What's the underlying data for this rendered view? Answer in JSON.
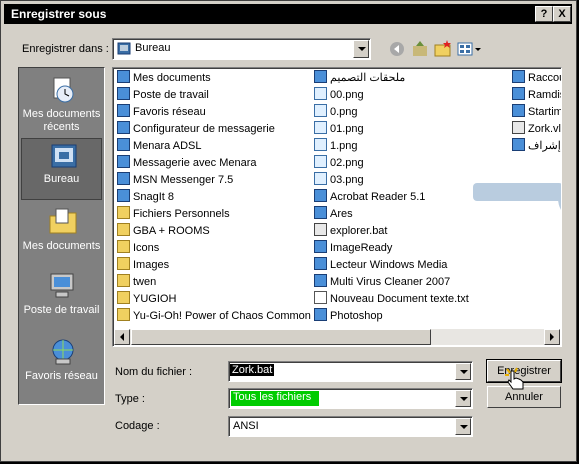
{
  "window": {
    "title": "Enregistrer sous",
    "help_button": "?",
    "close_button": "X"
  },
  "save_in": {
    "label": "Enregistrer dans :",
    "value": "Bureau"
  },
  "places": [
    {
      "label": "Mes documents récents",
      "icon": "recent-documents-icon"
    },
    {
      "label": "Bureau",
      "icon": "desktop-icon"
    },
    {
      "label": "Mes documents",
      "icon": "my-documents-icon"
    },
    {
      "label": "Poste de travail",
      "icon": "my-computer-icon"
    },
    {
      "label": "Favoris réseau",
      "icon": "network-places-icon"
    }
  ],
  "files_col1": [
    "Mes documents",
    "Poste de travail",
    "Favoris réseau",
    "Configurateur de messagerie",
    "Menara ADSL",
    "Messagerie avec Menara",
    "MSN Messenger 7.5",
    "SnagIt 8",
    "Fichiers Personnels",
    "GBA + ROOMS",
    "Icons",
    "Images",
    "twen",
    "YUGIOH",
    "Yu-Gi-Oh! Power of Chaos Common"
  ],
  "files_col2": [
    "ملحقات التصميم",
    "00.png",
    "0.png",
    "01.png",
    "1.png",
    "02.png",
    "03.png",
    "Acrobat Reader 5.1",
    "Ares",
    "explorer.bat",
    "ImageReady",
    "Lecteur Windows Media",
    "Multi Virus Cleaner 2007",
    "Nouveau Document texte.txt",
    "Photoshop"
  ],
  "files_col3": [
    "Raccou",
    "Ramdis",
    "Startim",
    "Zork.vl",
    "إشراف"
  ],
  "filename": {
    "label": "Nom du fichier :",
    "value": "Zork.bat"
  },
  "filetype": {
    "label": "Type :",
    "value": "Tous les fichiers"
  },
  "encoding": {
    "label": "Codage :",
    "value": "ANSI"
  },
  "buttons": {
    "save": "Enregistrer",
    "cancel": "Annuler"
  },
  "colors": {
    "titlebar": "#000000",
    "dialog_bg": "#d4d0c8",
    "places_bg": "#808080",
    "type_highlight": "#00cc00"
  }
}
